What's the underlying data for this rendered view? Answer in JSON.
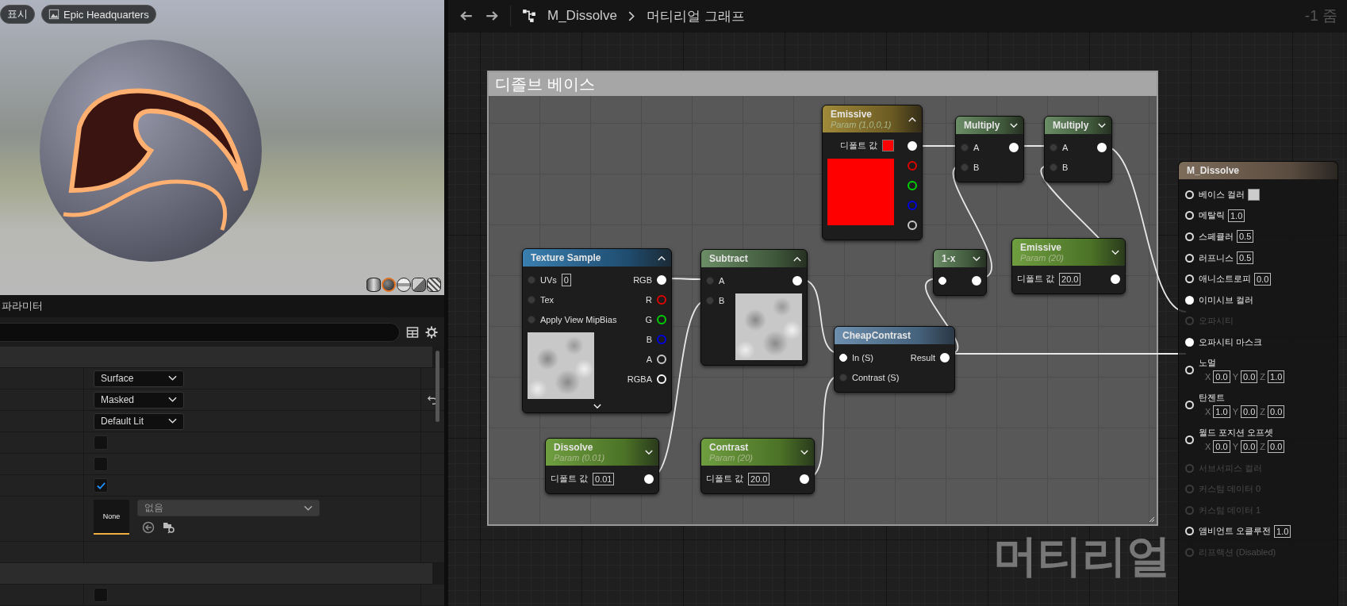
{
  "viewport": {
    "buttons": [
      {
        "kind": "menu",
        "label": "표시"
      },
      {
        "kind": "scene",
        "label": "Epic Headquarters"
      }
    ],
    "preview_shapes": [
      {
        "kind": "cylinder",
        "selected": false
      },
      {
        "kind": "sphere",
        "selected": true
      },
      {
        "kind": "plane",
        "selected": false
      },
      {
        "kind": "cube",
        "selected": false
      },
      {
        "kind": "mesh",
        "selected": false
      }
    ]
  },
  "parameters": {
    "title": "파라미터",
    "rows": [
      {
        "kind": "section"
      },
      {
        "kind": "dropdown",
        "value": "Surface"
      },
      {
        "kind": "dropdown",
        "value": "Masked",
        "resettable": true
      },
      {
        "kind": "dropdown",
        "value": "Default Lit"
      },
      {
        "kind": "checkbox",
        "checked": false
      },
      {
        "kind": "checkbox",
        "checked": false
      },
      {
        "kind": "checkbox",
        "checked": true
      },
      {
        "kind": "texture",
        "thumbnail": "None",
        "value": "없음"
      },
      {
        "kind": "blank"
      },
      {
        "kind": "section"
      },
      {
        "kind": "checkbox",
        "checked": false
      }
    ]
  },
  "graph": {
    "breadcrumb": {
      "asset": "M_Dissolve",
      "graph": "머티리얼 그래프"
    },
    "zoom": "-1 줌",
    "comment": "디졸브 베이스",
    "corner_label": "머티리얼",
    "nodes": [
      {
        "kind": "vector_param",
        "title": "Emissive",
        "subtitle": "Param (1,0,0,1)",
        "expanded": true,
        "preview": true,
        "default": {
          "label": "디폴트 값",
          "color": "#ff0000"
        },
        "outputs": [
          {
            "filled": true,
            "color": "#ffffff"
          },
          {
            "filled": false,
            "color": "#e00000"
          },
          {
            "filled": false,
            "color": "#00d000"
          },
          {
            "filled": false,
            "color": "#0000e0"
          },
          {
            "filled": false,
            "color": "#c8c8c8"
          }
        ]
      },
      {
        "kind": "math",
        "title": "Multiply",
        "expanded": false,
        "inputs": [
          {
            "label": "A",
            "filled": false
          },
          {
            "label": "B",
            "filled": false
          }
        ],
        "outputs": [
          {
            "filled": true,
            "color": "#ffffff"
          }
        ]
      },
      {
        "kind": "math",
        "title": "Multiply",
        "expanded": false,
        "inputs": [
          {
            "label": "A",
            "filled": false
          },
          {
            "label": "B",
            "filled": false
          }
        ],
        "outputs": [
          {
            "filled": true,
            "color": "#ffffff"
          }
        ]
      },
      {
        "kind": "texture",
        "title": "Texture Sample",
        "expanded": true,
        "advanced_toggle": true,
        "preview": true,
        "inputs": [
          {
            "label": "UVs",
            "value": "0",
            "filled": false
          },
          {
            "label": "Tex",
            "filled": false
          },
          {
            "label": "Apply View MipBias",
            "filled": false
          }
        ],
        "outputs": [
          {
            "label": "RGB",
            "filled": true,
            "color": "#ffffff"
          },
          {
            "label": "R",
            "filled": false,
            "color": "#e00000"
          },
          {
            "label": "G",
            "filled": false,
            "color": "#00d000"
          },
          {
            "label": "B",
            "filled": false,
            "color": "#0000e0"
          },
          {
            "label": "A",
            "filled": false,
            "color": "#c8c8c8"
          },
          {
            "label": "RGBA",
            "filled": false,
            "color": "#ffffff"
          }
        ]
      },
      {
        "kind": "math",
        "title": "Subtract",
        "expanded": true,
        "preview": true,
        "inputs": [
          {
            "label": "A",
            "filled": false
          },
          {
            "label": "B",
            "filled": false
          }
        ],
        "outputs": [
          {
            "filled": true,
            "color": "#ffffff"
          }
        ]
      },
      {
        "kind": "math",
        "title": "1-x",
        "expanded": false,
        "inputs": [
          {
            "filled": true
          }
        ],
        "outputs": [
          {
            "filled": true,
            "color": "#ffffff"
          }
        ]
      },
      {
        "kind": "scalar_param",
        "title": "Emissive",
        "subtitle": "Param (20)",
        "expanded": false,
        "default": {
          "label": "디폴트 값",
          "value": "20.0"
        },
        "outputs": [
          {
            "filled": true,
            "color": "#ffffff"
          }
        ]
      },
      {
        "kind": "function",
        "title": "CheapContrast",
        "inputs": [
          {
            "label": "In (S)",
            "filled": true
          },
          {
            "label": "Contrast (S)",
            "filled": false
          }
        ],
        "outputs": [
          {
            "label": "Result",
            "filled": true,
            "color": "#ffffff"
          }
        ]
      },
      {
        "kind": "scalar_param",
        "title": "Dissolve",
        "subtitle": "Param (0.01)",
        "expanded": false,
        "default": {
          "label": "디폴트 값",
          "value": "0.01"
        },
        "outputs": [
          {
            "filled": true,
            "color": "#ffffff"
          }
        ]
      },
      {
        "kind": "scalar_param",
        "title": "Contrast",
        "subtitle": "Param (20)",
        "expanded": false,
        "default": {
          "label": "디폴트 값",
          "value": "20.0"
        },
        "outputs": [
          {
            "filled": true,
            "color": "#ffffff"
          }
        ]
      }
    ],
    "result_node": {
      "title": "M_Dissolve",
      "pins": [
        {
          "kind": "color",
          "label": "베이스 컬러",
          "color": "#cccccc",
          "filled": false,
          "disabled": false
        },
        {
          "kind": "scalar",
          "label": "메탈릭",
          "value": "1.0",
          "filled": false,
          "disabled": false
        },
        {
          "kind": "scalar",
          "label": "스페큘러",
          "value": "0.5",
          "filled": false,
          "disabled": false
        },
        {
          "kind": "scalar",
          "label": "러프니스",
          "value": "0.5",
          "filled": false,
          "disabled": false
        },
        {
          "kind": "scalar",
          "label": "애니소트로피",
          "value": "0.0",
          "filled": false,
          "disabled": false
        },
        {
          "kind": "plain",
          "label": "이미시브 컬러",
          "filled": true,
          "disabled": false
        },
        {
          "kind": "plain",
          "label": "오파시티",
          "filled": false,
          "disabled": true
        },
        {
          "kind": "plain",
          "label": "오파시티 마스크",
          "filled": true,
          "disabled": false
        },
        {
          "kind": "vector",
          "label": "노멀",
          "axes": [
            {
              "axis": "X",
              "value": "0.0"
            },
            {
              "axis": "Y",
              "value": "0.0"
            },
            {
              "axis": "Z",
              "value": "1.0"
            }
          ],
          "filled": false,
          "disabled": false
        },
        {
          "kind": "vector",
          "label": "탄젠트",
          "axes": [
            {
              "axis": "X",
              "value": "1.0"
            },
            {
              "axis": "Y",
              "value": "0.0"
            },
            {
              "axis": "Z",
              "value": "0.0"
            }
          ],
          "filled": false,
          "disabled": false
        },
        {
          "kind": "vector",
          "label": "월드 포지션 오프셋",
          "axes": [
            {
              "axis": "X",
              "value": "0.0"
            },
            {
              "axis": "Y",
              "value": "0.0"
            },
            {
              "axis": "Z",
              "value": "0.0"
            }
          ],
          "filled": false,
          "disabled": false
        },
        {
          "kind": "plain",
          "label": "서브서피스 컬러",
          "filled": false,
          "disabled": true
        },
        {
          "kind": "plain",
          "label": "커스텀 데이터 0",
          "filled": false,
          "disabled": true
        },
        {
          "kind": "plain",
          "label": "커스텀 데이터 1",
          "filled": false,
          "disabled": true
        },
        {
          "kind": "scalar",
          "label": "앰비언트 오클루전",
          "value": "1.0",
          "filled": false,
          "disabled": false
        },
        {
          "kind": "plain",
          "label": "리프랙션 (Disabled)",
          "filled": false,
          "disabled": true
        }
      ]
    }
  }
}
